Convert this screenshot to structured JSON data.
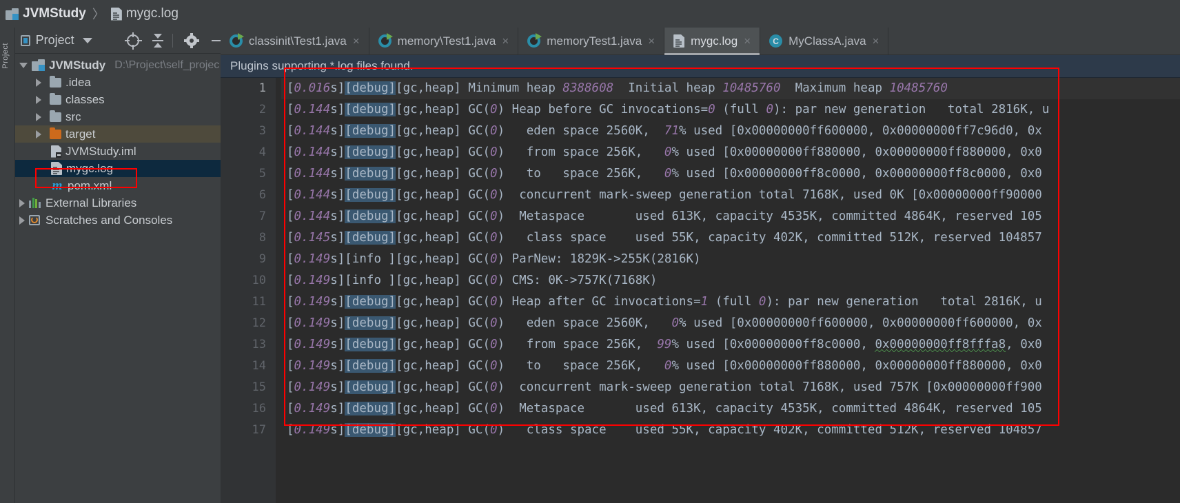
{
  "breadcrumb": {
    "project": "JVMStudy",
    "separator": "〉",
    "file": "mygc.log"
  },
  "left_strip": {
    "label": "Project"
  },
  "project_panel": {
    "title": "Project",
    "icons": [
      "locate-icon",
      "collapse-all-icon",
      "settings-gear-icon",
      "hide-icon"
    ],
    "tree": [
      {
        "label": "JVMStudy",
        "path": "D:\\Project\\self_projec",
        "icon": "module-icon",
        "state": "expanded",
        "depth": 0,
        "bold": true
      },
      {
        "label": ".idea",
        "icon": "folder-icon",
        "state": "collapsed",
        "depth": 1
      },
      {
        "label": "classes",
        "icon": "folder-icon",
        "state": "collapsed",
        "depth": 1
      },
      {
        "label": "src",
        "icon": "folder-icon",
        "state": "collapsed",
        "depth": 1
      },
      {
        "label": "target",
        "icon": "folder-orange-icon",
        "state": "collapsed",
        "depth": 1,
        "highlight": true
      },
      {
        "label": "JVMStudy.iml",
        "icon": "iml-file-icon",
        "state": "leaf",
        "depth": 2
      },
      {
        "label": "mygc.log",
        "icon": "log-file-icon",
        "state": "leaf",
        "depth": 2,
        "selected": true,
        "annotated": true
      },
      {
        "label": "pom.xml",
        "icon": "maven-icon",
        "state": "leaf",
        "depth": 2
      },
      {
        "label": "External Libraries",
        "icon": "libraries-icon",
        "state": "collapsed",
        "depth": 0
      },
      {
        "label": "Scratches and Consoles",
        "icon": "scratches-icon",
        "state": "collapsed",
        "depth": 0
      }
    ]
  },
  "editor": {
    "tabs": [
      {
        "label": "classinit\\Test1.java",
        "icon": "java-runnable-icon",
        "close": "×",
        "active": false
      },
      {
        "label": "memory\\Test1.java",
        "icon": "java-runnable-icon",
        "close": "×",
        "active": false
      },
      {
        "label": "memoryTest1.java",
        "icon": "java-runnable-icon",
        "close": "×",
        "active": false
      },
      {
        "label": "mygc.log",
        "icon": "log-file-icon",
        "close": "×",
        "active": true
      },
      {
        "label": "MyClassA.java",
        "icon": "java-class-icon",
        "close": "×",
        "active": false
      }
    ],
    "notification": "Plugins supporting *.log files found.",
    "line_numbers": [
      "1",
      "2",
      "3",
      "4",
      "5",
      "6",
      "7",
      "8",
      "9",
      "10",
      "11",
      "12",
      "13",
      "14",
      "15",
      "16",
      "17"
    ],
    "lines": [
      "[0.016s][debug][gc,heap] Minimum heap 8388608  Initial heap 10485760  Maximum heap 10485760",
      "[0.144s][debug][gc,heap] GC(0) Heap before GC invocations=0 (full 0): par new generation   total 2816K, u",
      "[0.144s][debug][gc,heap] GC(0)   eden space 2560K,  71% used [0x00000000ff600000, 0x00000000ff7c96d0, 0x",
      "[0.144s][debug][gc,heap] GC(0)   from space 256K,   0% used [0x00000000ff880000, 0x00000000ff880000, 0x0",
      "[0.144s][debug][gc,heap] GC(0)   to   space 256K,   0% used [0x00000000ff8c0000, 0x00000000ff8c0000, 0x0",
      "[0.144s][debug][gc,heap] GC(0)  concurrent mark-sweep generation total 7168K, used 0K [0x00000000ff90000",
      "[0.144s][debug][gc,heap] GC(0)  Metaspace       used 613K, capacity 4535K, committed 4864K, reserved 105",
      "[0.145s][debug][gc,heap] GC(0)   class space    used 55K, capacity 402K, committed 512K, reserved 104857",
      "[0.149s][info ][gc,heap] GC(0) ParNew: 1829K->255K(2816K)",
      "[0.149s][info ][gc,heap] GC(0) CMS: 0K->757K(7168K)",
      "[0.149s][debug][gc,heap] GC(0) Heap after GC invocations=1 (full 0): par new generation   total 2816K, u",
      "[0.149s][debug][gc,heap] GC(0)   eden space 2560K,   0% used [0x00000000ff600000, 0x00000000ff600000, 0x",
      "[0.149s][debug][gc,heap] GC(0)   from space 256K,  99% used [0x00000000ff8c0000, 0x00000000ff8fffa8, 0x0",
      "[0.149s][debug][gc,heap] GC(0)   to   space 256K,   0% used [0x00000000ff880000, 0x00000000ff880000, 0x0",
      "[0.149s][debug][gc,heap] GC(0)  concurrent mark-sweep generation total 7168K, used 757K [0x00000000ff900",
      "[0.149s][debug][gc,heap] GC(0)  Metaspace       used 613K, capacity 4535K, committed 4864K, reserved 105",
      "[0.149s][debug][gc,heap] GC(0)   class space    used 55K, capacity 402K, committed 512K, reserved 104857"
    ],
    "search_highlight_token": "[debug]"
  },
  "colors": {
    "accent_blue": "#3592c4",
    "annotation_red": "#fe0000",
    "selection_blue": "#0d293e",
    "highlight_blue": "#3a5871",
    "editor_bg": "#2b2b2b",
    "panel_bg": "#3c3f41",
    "number_literal": "#9876aa",
    "code_text": "#a9b7c6"
  }
}
